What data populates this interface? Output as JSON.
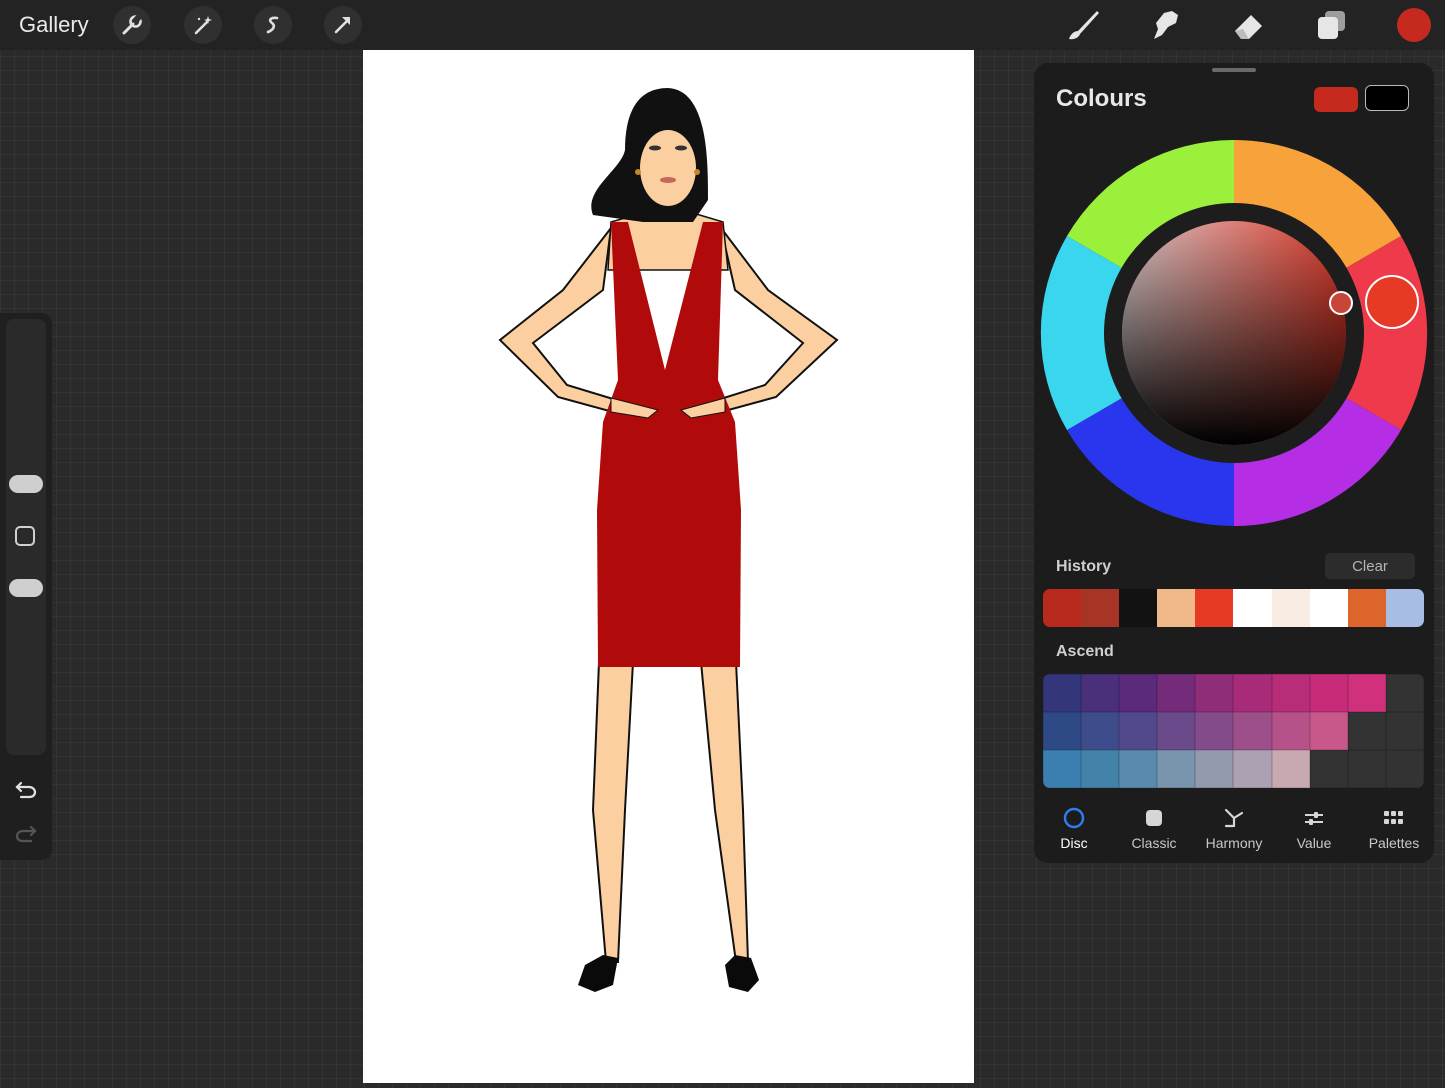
{
  "topbar": {
    "gallery_label": "Gallery",
    "left_tools": [
      "wrench-icon",
      "magic-wand-icon",
      "selection-icon",
      "transform-arrow-icon"
    ],
    "right_tools": [
      "brush-icon",
      "smudge-icon",
      "eraser-icon",
      "layers-icon"
    ],
    "current_color": "#c62a1e"
  },
  "panel": {
    "title": "Colours",
    "primary_color": "#c62a1e",
    "secondary_color": "#000000",
    "history_label": "History",
    "clear_label": "Clear",
    "history": [
      "#b82a1e",
      "#a83426",
      "#121212",
      "#f1b98a",
      "#e63a24",
      "#ffffff",
      "#f9ece2",
      "#ffffff",
      "#dc652a",
      "#a7bde3"
    ],
    "palette_name": "Ascend",
    "palette": [
      [
        "#33367a",
        "#4a2f7a",
        "#5b2a7a",
        "#742b79",
        "#8f2d79",
        "#a72b78",
        "#b72d77",
        "#c72c7a",
        "#d0307c",
        "#333333"
      ],
      [
        "#2d4a86",
        "#3e4c8c",
        "#52498a",
        "#6a4a8a",
        "#844b8a",
        "#9d4f8a",
        "#b5528a",
        "#c8578a",
        "#333333",
        "#333333"
      ],
      [
        "#3a7fb0",
        "#4383aa",
        "#5a8aae",
        "#7994ad",
        "#929aae",
        "#aba1b2",
        "#c8a9b0",
        "#333333",
        "#333333",
        "#333333"
      ]
    ],
    "tabs": [
      {
        "label": "Disc",
        "icon": "disc-icon",
        "active": true
      },
      {
        "label": "Classic",
        "icon": "classic-icon",
        "active": false
      },
      {
        "label": "Harmony",
        "icon": "harmony-icon",
        "active": false
      },
      {
        "label": "Value",
        "icon": "value-sliders-icon",
        "active": false
      },
      {
        "label": "Palettes",
        "icon": "palettes-grid-icon",
        "active": false
      }
    ]
  }
}
